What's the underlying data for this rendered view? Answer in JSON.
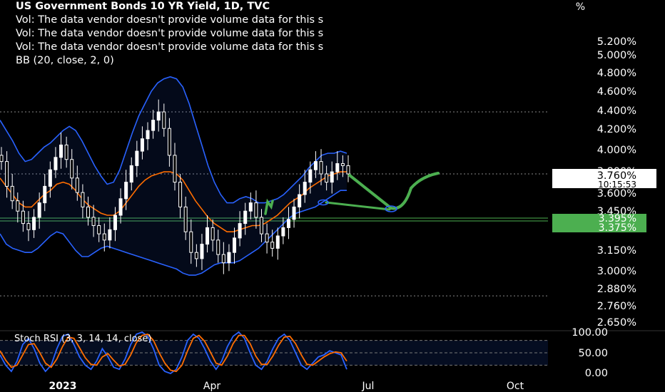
{
  "header": {
    "title": "US Government Bonds 10 YR Yield, 1D, TVC",
    "vol_lines": [
      "Vol: The data vendor doesn't provide volume data for this s",
      "Vol: The data vendor doesn't provide volume data for this s",
      "Vol: The data vendor doesn't provide volume data for this s"
    ],
    "bb_label": "BB (20, close, 2, 0)",
    "percent_symbol": "%"
  },
  "colors": {
    "background": "#000000",
    "bb_band": "#2962ff",
    "bb_basis": "#ff6d00",
    "candle": "#ffffff",
    "drawing": "#4caf50",
    "stoch_k": "#2962ff",
    "stoch_d": "#ff6d00",
    "axis_text": "#ffffff",
    "price_tag_bg": "#ffffff",
    "price_tag_text": "#000000",
    "level_tag_bg": "#4caf50"
  },
  "chart_data": [
    {
      "type": "candlestick",
      "title": "US Government Bonds 10 YR Yield, 1D, TVC",
      "y_unit": "%",
      "y_ticks": [
        "5.200%",
        "5.000%",
        "4.800%",
        "4.600%",
        "4.400%",
        "4.200%",
        "4.000%",
        "3.800%",
        "3.600%",
        "3.450%",
        "3.150%",
        "3.000%",
        "2.880%",
        "2.760%",
        "2.650%"
      ],
      "x_ticks": [
        "2023",
        "Apr",
        "Jul",
        "Oct"
      ],
      "current_price": "3.760%",
      "countdown": "10:15:53",
      "level_tags": [
        "3.395%",
        "3.375%"
      ],
      "close_series": [
        3.82,
        3.7,
        3.63,
        3.58,
        3.52,
        3.49,
        3.55,
        3.62,
        3.7,
        3.78,
        3.84,
        3.9,
        3.83,
        3.74,
        3.67,
        3.6,
        3.55,
        3.51,
        3.47,
        3.44,
        3.49,
        3.56,
        3.64,
        3.72,
        3.8,
        3.87,
        3.93,
        3.97,
        4.02,
        4.06,
        3.98,
        3.85,
        3.72,
        3.6,
        3.48,
        3.38,
        3.35,
        3.42,
        3.5,
        3.44,
        3.37,
        3.33,
        3.38,
        3.45,
        3.52,
        3.58,
        3.62,
        3.55,
        3.47,
        3.43,
        3.4,
        3.46,
        3.5,
        3.54,
        3.6,
        3.66,
        3.72,
        3.78,
        3.82,
        3.76,
        3.72,
        3.77,
        3.81,
        3.8,
        3.76
      ],
      "bb_upper": [
        4.02,
        3.97,
        3.92,
        3.86,
        3.82,
        3.83,
        3.86,
        3.89,
        3.91,
        3.94,
        3.97,
        3.99,
        3.97,
        3.92,
        3.86,
        3.8,
        3.75,
        3.71,
        3.72,
        3.78,
        3.87,
        3.96,
        4.04,
        4.1,
        4.16,
        4.2,
        4.22,
        4.23,
        4.22,
        4.18,
        4.1,
        4.0,
        3.9,
        3.8,
        3.72,
        3.66,
        3.62,
        3.62,
        3.64,
        3.65,
        3.64,
        3.62,
        3.62,
        3.63,
        3.64,
        3.66,
        3.69,
        3.72,
        3.75,
        3.79,
        3.82,
        3.85,
        3.86,
        3.86,
        3.87,
        3.86
      ],
      "bb_lower": [
        3.47,
        3.42,
        3.4,
        3.39,
        3.38,
        3.38,
        3.4,
        3.43,
        3.46,
        3.48,
        3.47,
        3.43,
        3.39,
        3.36,
        3.36,
        3.38,
        3.4,
        3.41,
        3.4,
        3.39,
        3.38,
        3.37,
        3.36,
        3.35,
        3.34,
        3.33,
        3.32,
        3.31,
        3.3,
        3.28,
        3.27,
        3.27,
        3.28,
        3.3,
        3.32,
        3.33,
        3.33,
        3.33,
        3.34,
        3.36,
        3.38,
        3.4,
        3.43,
        3.46,
        3.49,
        3.52,
        3.55,
        3.57,
        3.58,
        3.59,
        3.6,
        3.62,
        3.64,
        3.66,
        3.68,
        3.68
      ],
      "bb_basis": [
        3.74,
        3.7,
        3.66,
        3.62,
        3.6,
        3.6,
        3.63,
        3.66,
        3.68,
        3.71,
        3.72,
        3.71,
        3.68,
        3.64,
        3.61,
        3.59,
        3.57,
        3.56,
        3.56,
        3.58,
        3.62,
        3.66,
        3.7,
        3.73,
        3.75,
        3.76,
        3.77,
        3.77,
        3.76,
        3.73,
        3.68,
        3.63,
        3.59,
        3.55,
        3.52,
        3.5,
        3.48,
        3.48,
        3.49,
        3.5,
        3.51,
        3.51,
        3.52,
        3.54,
        3.56,
        3.59,
        3.62,
        3.64,
        3.66,
        3.69,
        3.71,
        3.73,
        3.75,
        3.76,
        3.77,
        3.77
      ]
    },
    {
      "type": "line",
      "title": "Stoch RSI (3, 3, 14, 14, close)",
      "y_ticks": [
        "100.00",
        "50.00",
        "0.00"
      ],
      "ylim": [
        0,
        100
      ],
      "series": [
        {
          "name": "K",
          "values": [
            45,
            20,
            5,
            30,
            70,
            85,
            60,
            25,
            5,
            20,
            60,
            90,
            95,
            70,
            40,
            20,
            10,
            30,
            60,
            40,
            15,
            10,
            35,
            70,
            95,
            100,
            90,
            60,
            20,
            5,
            0,
            10,
            40,
            80,
            95,
            85,
            60,
            30,
            10,
            30,
            65,
            90,
            100,
            85,
            50,
            20,
            10,
            30,
            60,
            85,
            95,
            80,
            50,
            20,
            10,
            25,
            40,
            45,
            55,
            50,
            45,
            10
          ]
        },
        {
          "name": "D",
          "values": [
            55,
            32,
            15,
            20,
            45,
            70,
            72,
            50,
            25,
            15,
            35,
            65,
            88,
            85,
            62,
            38,
            22,
            20,
            40,
            48,
            32,
            18,
            22,
            45,
            75,
            92,
            95,
            80,
            50,
            25,
            8,
            5,
            20,
            55,
            85,
            92,
            78,
            52,
            25,
            20,
            42,
            72,
            92,
            92,
            72,
            42,
            22,
            22,
            42,
            68,
            88,
            90,
            72,
            45,
            22,
            20,
            30,
            40,
            48,
            52,
            50,
            30
          ]
        }
      ],
      "levels": [
        80,
        50,
        20
      ]
    }
  ]
}
